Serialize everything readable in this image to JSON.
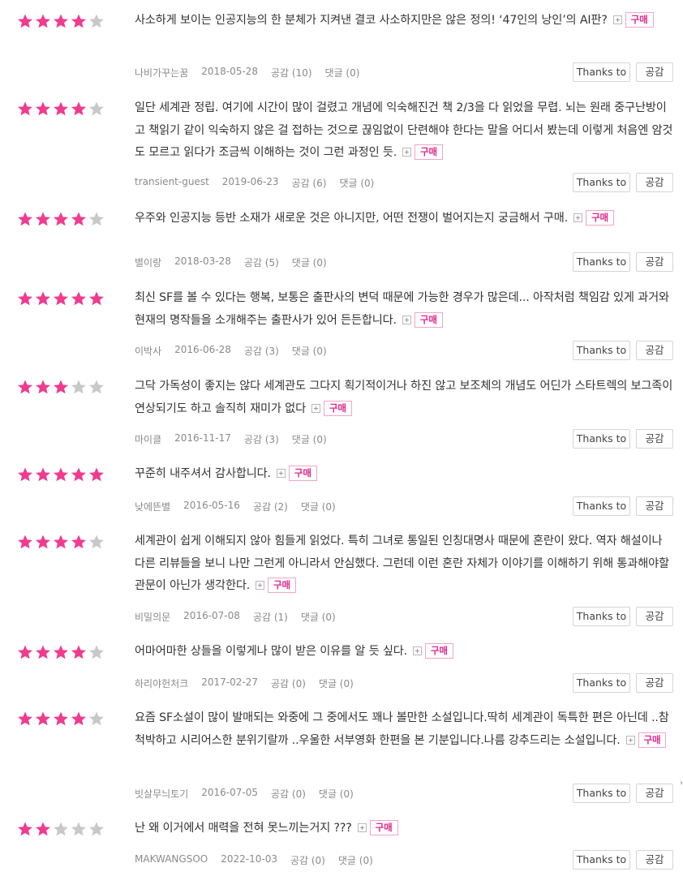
{
  "colors": {
    "star_on": "#ef3c8f",
    "star_off": "#c8c8c8",
    "badge": "#e0288c"
  },
  "labels": {
    "thanks": "Thanks to",
    "like": "공감",
    "buy": "구매"
  },
  "reviews": [
    {
      "rating": 4,
      "text": "사소하게 보이는 인공지능의 한 분체가 지켜낸 결코 사소하지만은 않은 정의! ‘47인의 낭인’의 AI판?",
      "author": "나비가꾸는꿈",
      "date": "2018-05-28",
      "likes": "공감 (10)",
      "comments": "댓글 (0)"
    },
    {
      "rating": 4,
      "text": "일단 세계관 정립. 여기에 시간이 많이 걸렸고 개념에 익숙해진건 책 2/3을 다 읽었을 무렵. 뇌는 원래 중구난방이고 책읽기 같이 익숙하지 않은 걸 접하는 것으로 끊임없이 단련해야 한다는 말을 어디서 봤는데 이렇게 처음엔 암것도 모르고 읽다가 조금씩 이해하는 것이 그런 과정인 듯.",
      "author": "transient-guest",
      "date": "2019-06-23",
      "likes": "공감 (6)",
      "comments": "댓글 (0)"
    },
    {
      "rating": 4,
      "text": "우주와 인공지능 등반 소재가 새로운 것은 아니지만, 어떤 전쟁이 벌어지는지 궁금해서 구매.",
      "author": "별이랑",
      "date": "2018-03-28",
      "likes": "공감 (5)",
      "comments": "댓글 (0)"
    },
    {
      "rating": 5,
      "text": "최신 SF를 볼 수 있다는 행복, 보통은 출판사의 변덕 때문에 가능한 경우가 많은데... 아작처럼 책임감 있게 과거와 현재의 명작들을 소개해주는 출판사가 있어 든든합니다.",
      "author": "이박사",
      "date": "2016-06-28",
      "likes": "공감 (3)",
      "comments": "댓글 (0)"
    },
    {
      "rating": 3,
      "text": "그닥 가독성이 좋지는 않다 세계관도 그다지 획기적이거나 하진 않고 보조체의 개념도 어딘가 스타트렉의 보그족이 연상되기도 하고 솔직히 재미가 없다",
      "author": "마이클",
      "date": "2016-11-17",
      "likes": "공감 (3)",
      "comments": "댓글 (0)"
    },
    {
      "rating": 5,
      "text": "꾸준히 내주셔서 감사합니다.",
      "author": "낮에뜬별",
      "date": "2016-05-16",
      "likes": "공감 (2)",
      "comments": "댓글 (0)"
    },
    {
      "rating": 4,
      "text": "세계관이 쉽게 이해되지 않아 힘들게 읽었다. 특히 그녀로 통일된 인칭대명사 때문에 혼란이 왔다. 역자 해설이나 다른 리뷰들을 보니 나만 그런게 아니라서 안심했다. 그런데 이런 혼란 자체가 이야기를 이해하기 위해 통과해야할 관문이 아닌가 생각한다.",
      "author": "비밀의문",
      "date": "2016-07-08",
      "likes": "공감 (1)",
      "comments": "댓글 (0)"
    },
    {
      "rating": 4,
      "text": "어마어마한 상들을 이렇게나 많이 받은 이유를 알 듯 싶다.",
      "author": "하리야헌처크",
      "date": "2017-02-27",
      "likes": "공감 (0)",
      "comments": "댓글 (0)"
    },
    {
      "rating": 4,
      "text": "요즘 SF소설이 많이 발매되는 와중에 그 중에서도 꽤나 볼만한 소설입니다.딱히 세계관이 독특한 편은 아닌데 ..참 척박하고 시리어스한 분위기랄까 ..우울한 서부영화 한편을 본 기분입니다.나름 강추드리는 소설입니다.",
      "author": "빗살무늬토기",
      "date": "2016-07-05",
      "likes": "공감 (0)",
      "comments": "댓글 (0)"
    },
    {
      "rating": 2,
      "text": "난 왜 이거에서 매력을 전혀 못느끼는거지 ???",
      "author": "MAKWANGSOO",
      "date": "2022-10-03",
      "likes": "공감 (0)",
      "comments": "댓글 (0)"
    }
  ],
  "edge_glyph": "›"
}
